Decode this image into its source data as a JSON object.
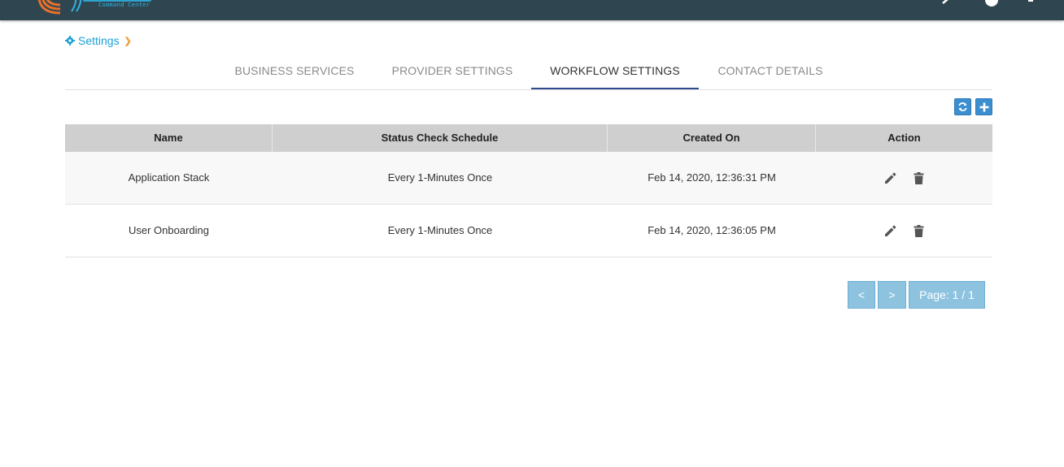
{
  "header": {
    "logo_subtitle": "Command Center"
  },
  "breadcrumb": {
    "label": "Settings",
    "separator": "❯"
  },
  "tabs": [
    {
      "label": "BUSINESS SERVICES"
    },
    {
      "label": "PROVIDER SETTINGS"
    },
    {
      "label": "WORKFLOW SETTINGS",
      "active": true
    },
    {
      "label": "CONTACT DETAILS"
    }
  ],
  "toolbar": {
    "refresh_icon": "refresh-icon",
    "add_icon": "plus-icon"
  },
  "table": {
    "columns": [
      "Name",
      "Status Check Schedule",
      "Created On",
      "Action"
    ],
    "rows": [
      {
        "name": "Application Stack",
        "schedule": "Every 1-Minutes Once",
        "created": "Feb 14, 2020, 12:36:31 PM"
      },
      {
        "name": "User Onboarding",
        "schedule": "Every 1-Minutes Once",
        "created": "Feb 14, 2020, 12:36:05 PM"
      }
    ]
  },
  "pagination": {
    "prev": "<",
    "next": ">",
    "page_label": "Page: 1 / 1"
  },
  "colors": {
    "topbar": "#2f4650",
    "accent": "#1ea0d6",
    "active_tab_underline": "#2f4a8c",
    "button_blue": "#3b8fd0",
    "pager_blue": "#8ec3e0"
  }
}
